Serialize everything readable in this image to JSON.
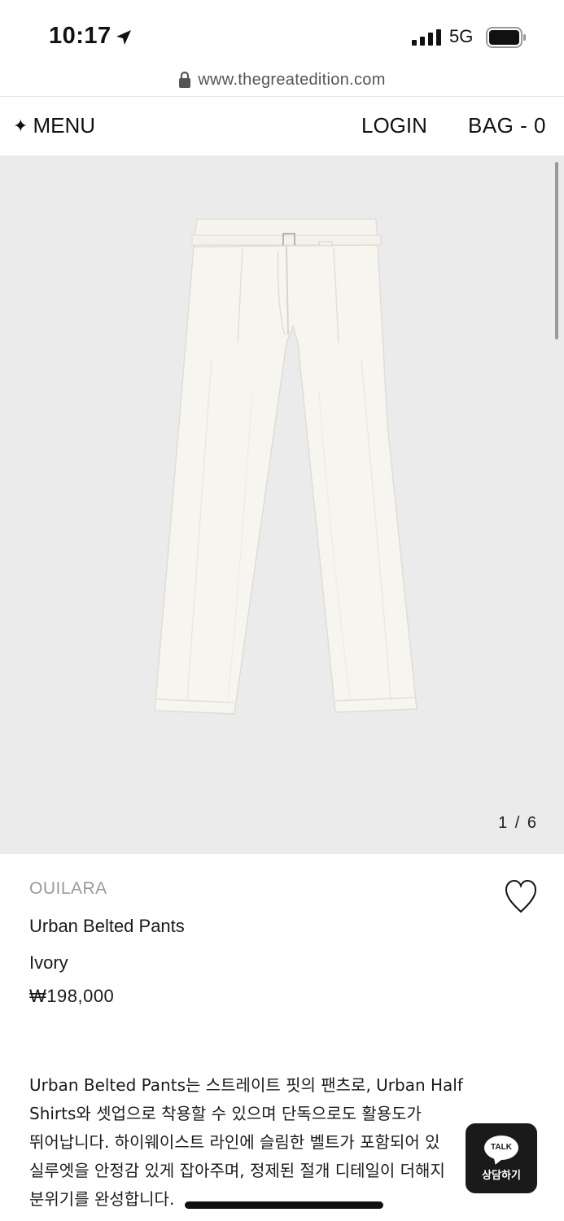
{
  "status_bar": {
    "time": "10:17",
    "network": "5G",
    "icons": [
      "location-arrow-icon",
      "signal-icon",
      "battery-icon"
    ]
  },
  "browser": {
    "url": "www.thegreatedition.com"
  },
  "nav": {
    "menu_icon": "✦",
    "menu_label": "MENU",
    "login_label": "LOGIN",
    "bag_label": "BAG - 0"
  },
  "gallery": {
    "background": "#ebebeb",
    "image": "ivory-belted-pants",
    "counter": "1 / 6"
  },
  "product": {
    "brand": "OUILARA",
    "name": "Urban Belted Pants",
    "color": "Ivory",
    "price": "₩198,000",
    "wishlist_icon": "heart-outline-icon"
  },
  "description": {
    "lines": [
      "Urban Belted Pants는 스트레이트 핏의 팬츠로, Urban Half",
      "Shirts와 셋업으로 착용할 수 있으며 단독으로도 활용도가",
      "뛰어납니다. 하이웨이스트 라인에 슬림한 벨트가 포함되어 있",
      "실루엣을 안정감 있게 잡아주며, 정제된 절개 디테일이 더해지",
      "분위기를 완성합니다."
    ]
  },
  "chat_button": {
    "bubble_text": "TALK",
    "label": "상담하기"
  }
}
